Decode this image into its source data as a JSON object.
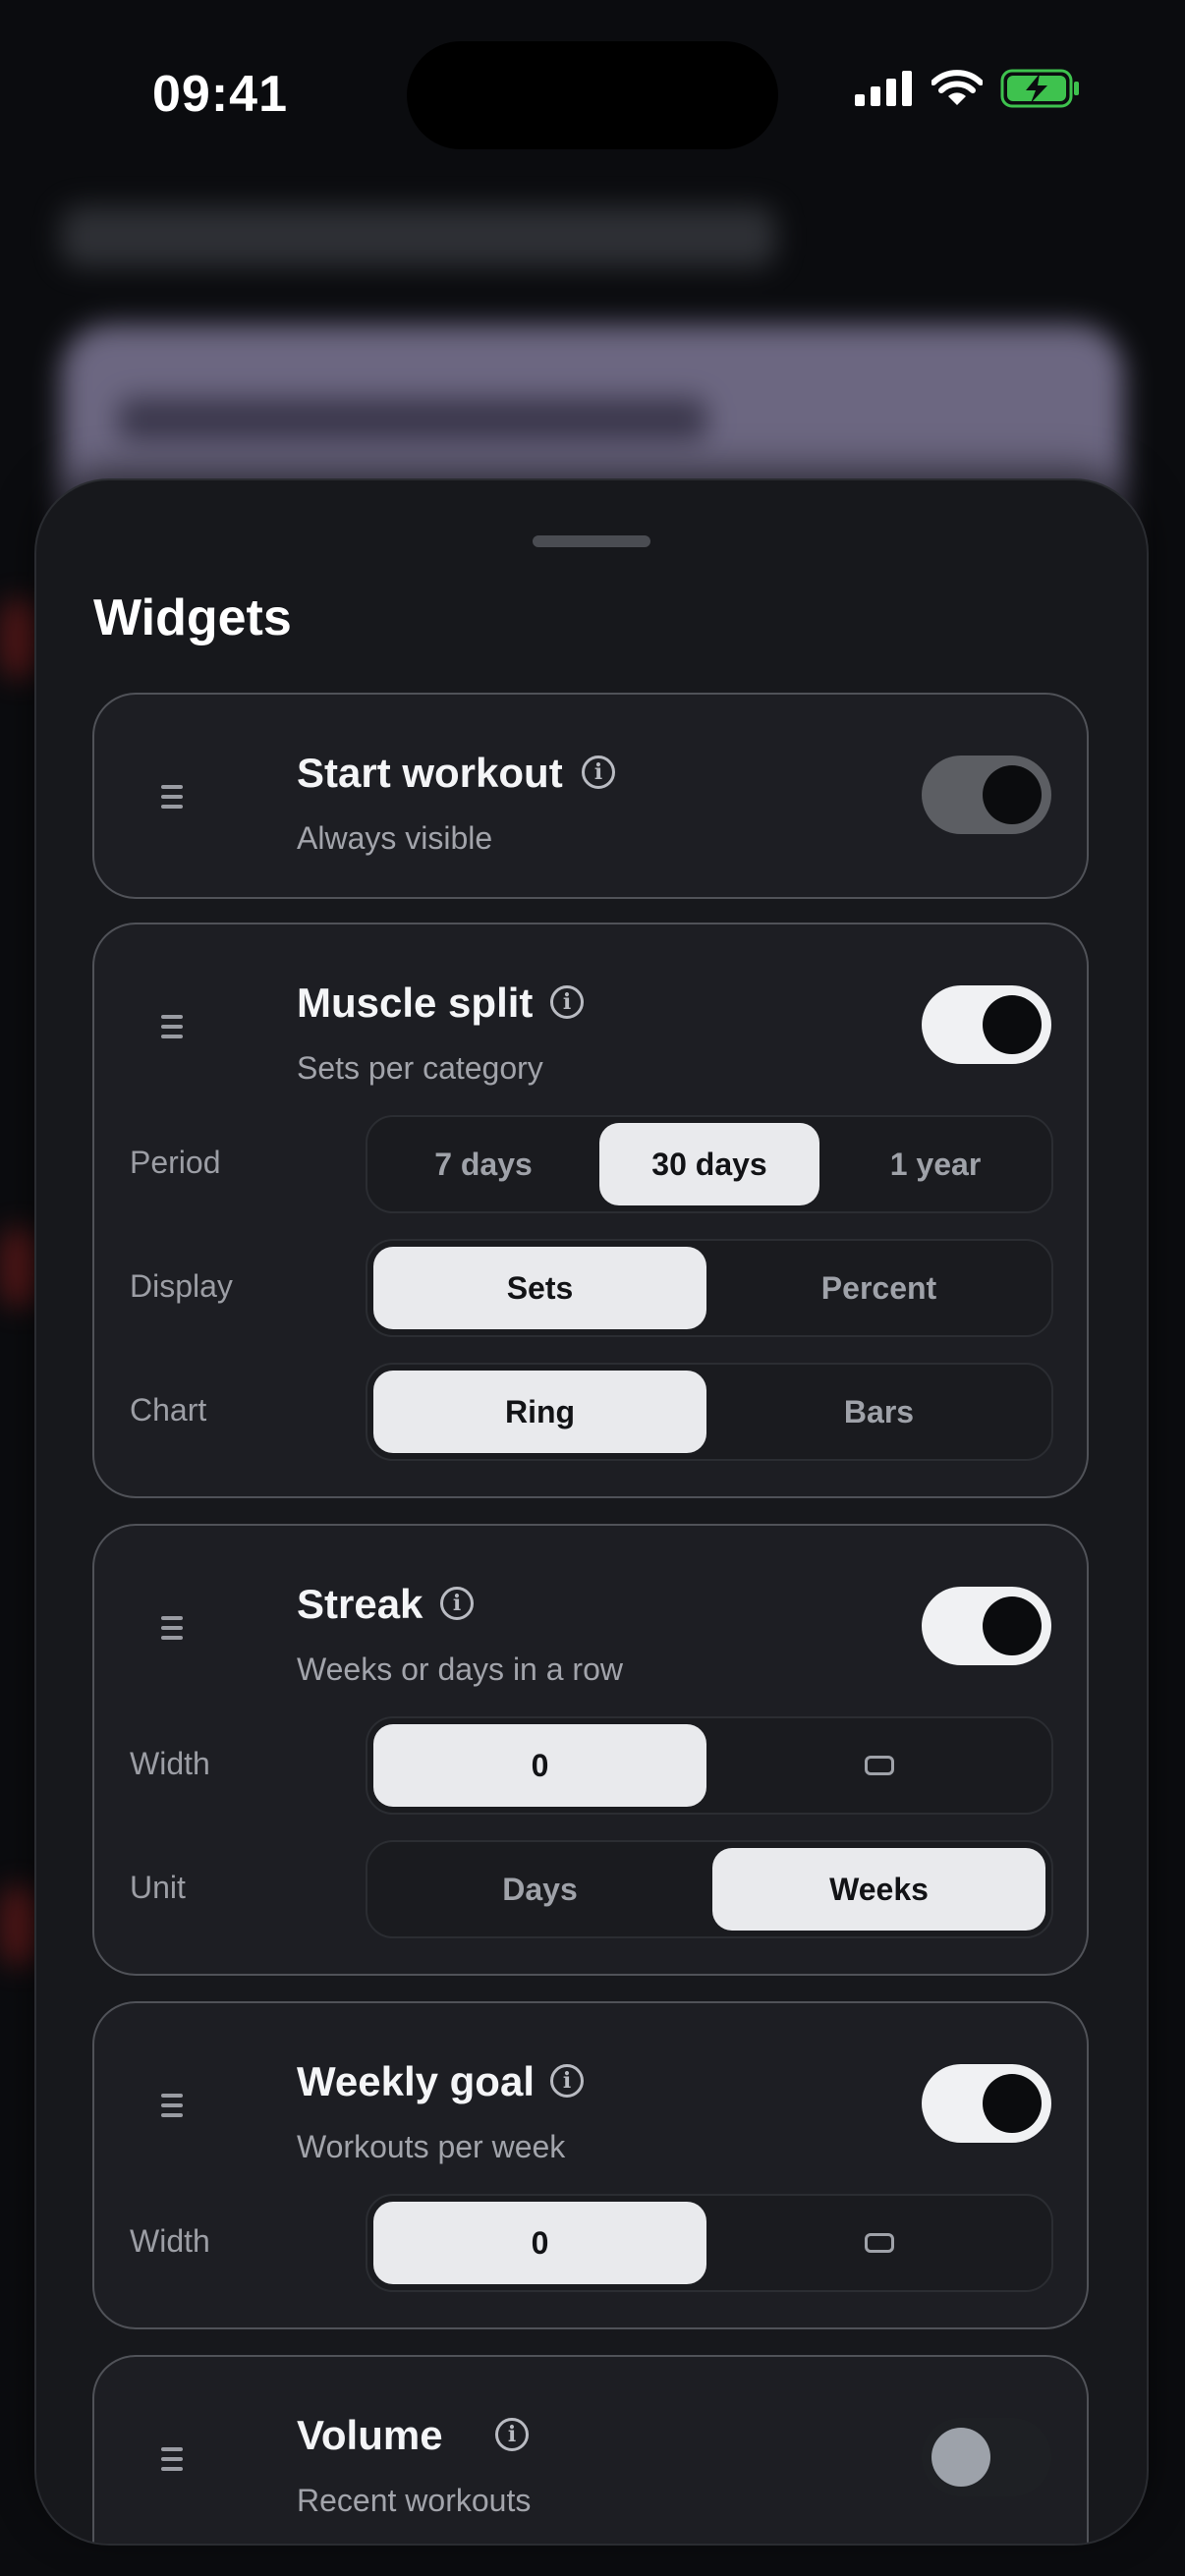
{
  "status_bar": {
    "time": "09:41"
  },
  "sheet": {
    "title": "Widgets",
    "widgets": [
      {
        "id": "start-workout",
        "title": "Start workout",
        "subtitle": "Always visible",
        "enabled": true,
        "toggle_locked": true
      },
      {
        "id": "muscle-split",
        "title": "Muscle split",
        "subtitle": "Sets per category",
        "enabled": true,
        "settings": [
          {
            "label": "Period",
            "options": [
              "7 days",
              "30 days",
              "1 year"
            ],
            "selected": "30 days"
          },
          {
            "label": "Display",
            "options": [
              "Sets",
              "Percent"
            ],
            "selected": "Sets"
          },
          {
            "label": "Chart",
            "options": [
              "Ring",
              "Bars"
            ],
            "selected": "Ring"
          }
        ]
      },
      {
        "id": "streak",
        "title": "Streak",
        "subtitle": "Weeks or days in a row",
        "enabled": true,
        "settings": [
          {
            "label": "Width",
            "options": [
              "0",
              "rect-icon"
            ],
            "selected": "0"
          },
          {
            "label": "Unit",
            "options": [
              "Days",
              "Weeks"
            ],
            "selected": "Weeks"
          }
        ]
      },
      {
        "id": "weekly-goal",
        "title": "Weekly goal",
        "subtitle": "Workouts per week",
        "enabled": true,
        "settings": [
          {
            "label": "Width",
            "options": [
              "0",
              "rect-icon"
            ],
            "selected": "0"
          }
        ]
      },
      {
        "id": "volume",
        "title": "Volume",
        "subtitle": "Recent workouts",
        "enabled": false
      }
    ]
  },
  "icons": [
    "cellular-signal-icon",
    "wifi-icon",
    "battery-charging-icon",
    "drag-handle-icon",
    "info-icon",
    "rect-icon"
  ],
  "colors": {
    "background": "#0b0c0f",
    "sheet": "#17181c",
    "card": "#1d1e23",
    "selected": "#e9eaed",
    "battery": "#3ec24e"
  }
}
